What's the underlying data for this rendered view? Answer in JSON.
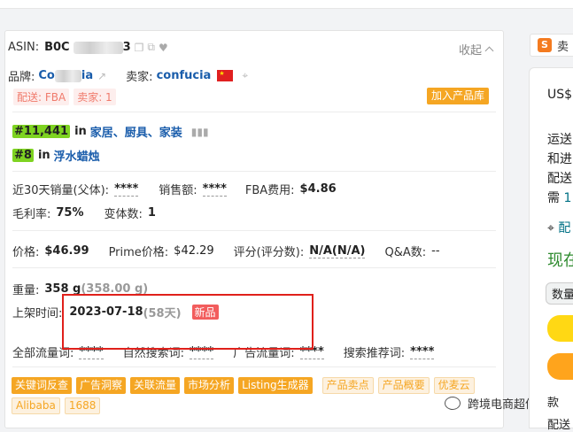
{
  "product": {
    "asin_label": "ASIN:",
    "asin_prefix": "B0C",
    "asin_suffix": "3",
    "collapse_label": "收起",
    "brand_label": "品牌:",
    "brand_value": "Co",
    "brand_value_end": "ia",
    "seller_label": "卖家:",
    "seller_value": "confucia",
    "tag_fba": "配送: FBA",
    "tag_seller_count": "卖家: 1",
    "add_library": "加入产品库"
  },
  "ranks": [
    {
      "rank": "#11,441",
      "in": "in",
      "category": "家居、厨具、家装"
    },
    {
      "rank": "#8",
      "in": "in",
      "category": "浮水蜡烛"
    }
  ],
  "stats1": {
    "sales30_label": "近30天销量(父体):",
    "sales30_value": "****",
    "revenue_label": "销售额:",
    "revenue_value": "****",
    "fba_label": "FBA费用:",
    "fba_value": "$4.86",
    "margin_label": "毛利率:",
    "margin_value": "75%",
    "variants_label": "变体数:",
    "variants_value": "1"
  },
  "stats2": {
    "price_label": "价格:",
    "price_value": "$46.99",
    "prime_label": "Prime价格:",
    "prime_value": "$42.29",
    "rating_label": "评分(评分数):",
    "rating_value": "N/A(N/A)",
    "qa_label": "Q&A数:",
    "qa_value": "--"
  },
  "stats3": {
    "weight_label": "重量:",
    "weight_value": "358 g",
    "weight_alt": "(358.00 g)",
    "listed_label": "上架时间:",
    "listed_value": "2023-07-18",
    "listed_days": "(58天)",
    "new_badge": "新品",
    "traffic_all_label": "全部流量词:",
    "traffic_all_value": "****",
    "organic_label": "自然搜索词:",
    "organic_value": "****",
    "ads_label": "广告流量词:",
    "ads_value": "****",
    "recommend_label": "搜索推荐词:",
    "recommend_value": "****"
  },
  "tools_solid": [
    "关键词反查",
    "广告洞察",
    "关联流量",
    "市场分析",
    "Listing生成器"
  ],
  "tools_outline": [
    "产品卖点",
    "产品概要",
    "优麦云",
    "Alibaba",
    "1688"
  ],
  "watermark": "跨境电商超仔",
  "right": {
    "tab_icon": "S",
    "tab_text": "卖",
    "price": "US$",
    "line1": "运送",
    "line2": "和进",
    "line3": "配送",
    "line4_a": "需",
    "line4_b": "1",
    "location": "配",
    "stock": "现在",
    "qty": "数量",
    "footer": "款",
    "footer2": "配送"
  },
  "colors": {
    "accent_orange": "#f5a623",
    "link_blue": "#1a5dab",
    "rank_green": "#7ed321",
    "new_red": "#f25d5d",
    "highlight_red": "#e0201b",
    "stock_green": "#2e8b2e"
  }
}
